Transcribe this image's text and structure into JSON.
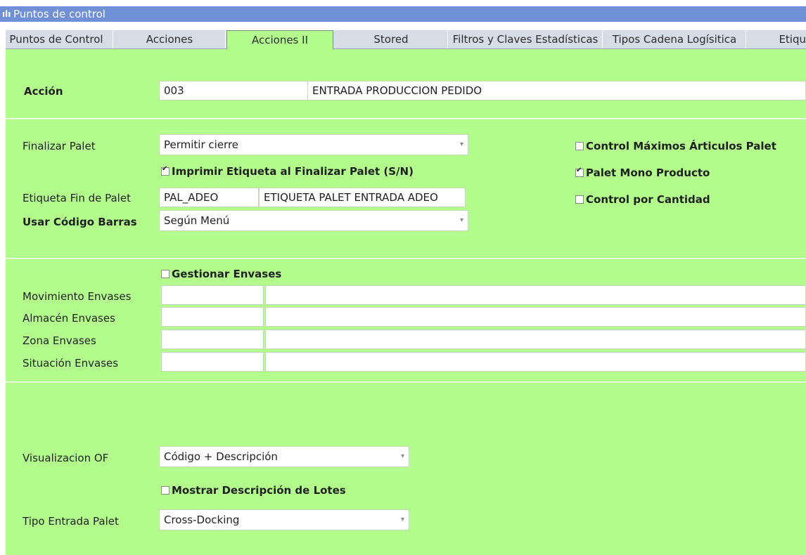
{
  "window": {
    "title": "Puntos de control"
  },
  "tabs": [
    {
      "label": "Puntos de Control",
      "active": false
    },
    {
      "label": "Acciones",
      "active": false
    },
    {
      "label": "Acciones II",
      "active": true
    },
    {
      "label": "Stored",
      "active": false
    },
    {
      "label": "Filtros y Claves Estadísticas",
      "active": false
    },
    {
      "label": "Tipos Cadena Logísitica",
      "active": false
    },
    {
      "label": "Etiqu",
      "active": false
    }
  ],
  "accion": {
    "label": "Acción",
    "code": "003",
    "description": "ENTRADA PRODUCCION PEDIDO"
  },
  "palet": {
    "finalizar_label": "Finalizar Palet",
    "finalizar_value": "Permitir cierre",
    "imprimir_label": "Imprimir Etiqueta al Finalizar Palet (S/N)",
    "imprimir_checked": true,
    "etiqueta_label": "Etiqueta Fin de Palet",
    "etiqueta_code": "PAL_ADEO",
    "etiqueta_desc": "ETIQUETA PALET ENTRADA ADEO",
    "barras_label": "Usar Código Barras",
    "barras_value": "Según Menú",
    "control_max_label": "Control Máximos Árticulos Palet",
    "control_max_checked": false,
    "mono_label": "Palet Mono Producto",
    "mono_checked": true,
    "control_cant_label": "Control por Cantidad",
    "control_cant_checked": false
  },
  "envases": {
    "gestionar_label": "Gestionar Envases",
    "gestionar_checked": false,
    "movimiento_label": "Movimiento Envases",
    "almacen_label": "Almacén Envases",
    "zona_label": "Zona Envases",
    "situacion_label": "Situación Envases"
  },
  "of": {
    "visualizacion_label": "Visualizacion OF",
    "visualizacion_value": "Código + Descripción",
    "lotes_label": "Mostrar Descripción de Lotes",
    "lotes_checked": false,
    "tipo_label": "Tipo Entrada Palet",
    "tipo_value": "Cross-Docking"
  }
}
